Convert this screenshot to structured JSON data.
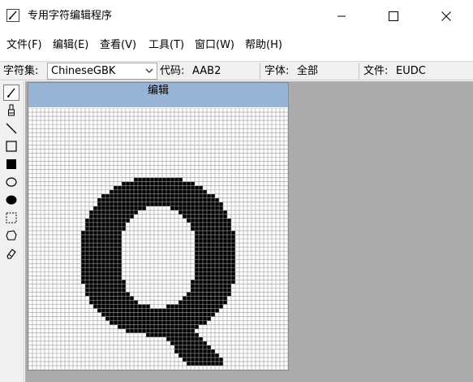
{
  "window": {
    "title": "专用字符编辑程序",
    "app_icon": "pencil-app-icon",
    "controls": [
      "minimize-icon",
      "maximize-icon",
      "close-icon"
    ]
  },
  "menu": [
    {
      "label": "文件(F)"
    },
    {
      "label": "编辑(E)"
    },
    {
      "label": "查看(V)"
    },
    {
      "label": "工具(T)"
    },
    {
      "label": "窗口(W)"
    },
    {
      "label": "帮助(H)"
    }
  ],
  "status": {
    "charset_label": "字符集:",
    "charset_value": "ChineseGBK",
    "code_label": "代码:",
    "code_value": "AAB2",
    "font_label": "字体:",
    "font_value": "全部",
    "file_label": "文件:",
    "file_value": "EUDC"
  },
  "tools": [
    {
      "icon": "pencil-icon",
      "active": true
    },
    {
      "icon": "brush-icon"
    },
    {
      "icon": "line-icon"
    },
    {
      "icon": "hollow-rectangle-icon"
    },
    {
      "icon": "filled-rectangle-icon"
    },
    {
      "icon": "hollow-ellipse-icon"
    },
    {
      "icon": "filled-ellipse-icon"
    },
    {
      "icon": "rectangle-select-icon"
    },
    {
      "icon": "freeform-select-icon"
    },
    {
      "icon": "eraser-icon"
    }
  ],
  "editor": {
    "title": "编辑",
    "glyph": "Q",
    "grid_size": 64,
    "colors": {
      "header": "#97b3d5",
      "grid_line": "#9a9a9a",
      "pixel_on": "#000000",
      "workspace": "#ababab"
    }
  }
}
